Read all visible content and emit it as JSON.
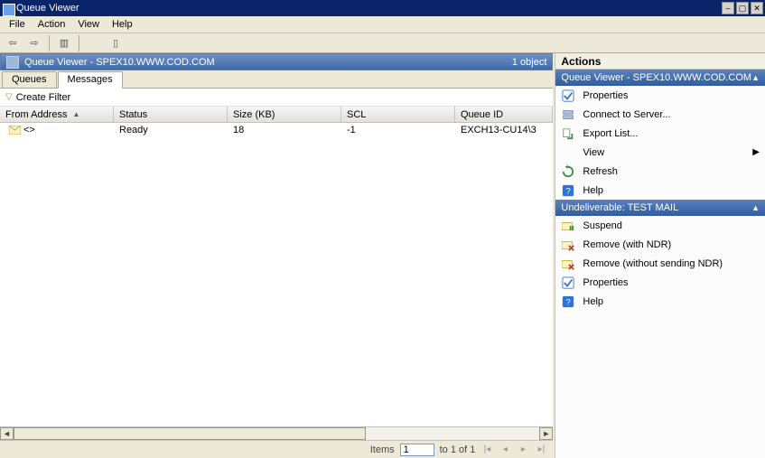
{
  "window": {
    "title": "Queue Viewer"
  },
  "menu": {
    "file": "File",
    "action": "Action",
    "view": "View",
    "help": "Help"
  },
  "view_header": {
    "title": "Queue Viewer - SPEX10.WWW.COD.COM",
    "count_label": "1 object"
  },
  "tabs": {
    "queues": "Queues",
    "messages": "Messages"
  },
  "filter": {
    "create": "Create Filter"
  },
  "columns": {
    "from": "From Address",
    "status": "Status",
    "size": "Size (KB)",
    "scl": "SCL",
    "qid": "Queue ID"
  },
  "rows": [
    {
      "from": "<>",
      "status": "Ready",
      "size": "18",
      "scl": "-1",
      "qid": "EXCH13-CU14\\3"
    }
  ],
  "paging": {
    "label": "Items",
    "page": "1",
    "of_text": "to 1 of 1"
  },
  "actions": {
    "pane_title": "Actions",
    "group1": {
      "title": "Queue Viewer - SPEX10.WWW.COD.COM",
      "properties": "Properties",
      "connect": "Connect to Server...",
      "export": "Export List...",
      "view": "View",
      "refresh": "Refresh",
      "help": "Help"
    },
    "group2": {
      "title": "Undeliverable: TEST MAIL",
      "suspend": "Suspend",
      "remove_ndr": "Remove (with NDR)",
      "remove_no_ndr": "Remove (without sending NDR)",
      "properties": "Properties",
      "help": "Help"
    }
  }
}
